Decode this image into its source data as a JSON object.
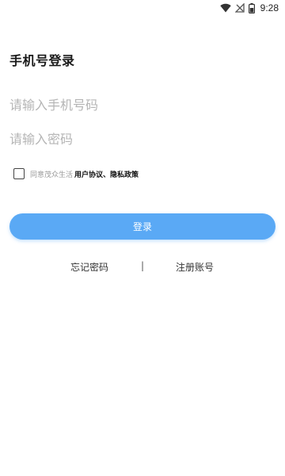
{
  "status_bar": {
    "time": "9:28",
    "icons": [
      "wifi-icon",
      "no-signal-icon",
      "battery-icon"
    ]
  },
  "login": {
    "title": "手机号登录",
    "phone_placeholder": "请输入手机号码",
    "password_placeholder": "请输入密码",
    "agreement_prefix": "同意茂众生活",
    "agreement_links": "用户协议、隐私政策",
    "login_label": "登录",
    "forgot_label": "忘记密码",
    "divider": "|",
    "register_label": "注册账号"
  },
  "colors": {
    "primary": "#5aa9f5",
    "placeholder": "#b5b5b5",
    "background": "#ffffff"
  }
}
